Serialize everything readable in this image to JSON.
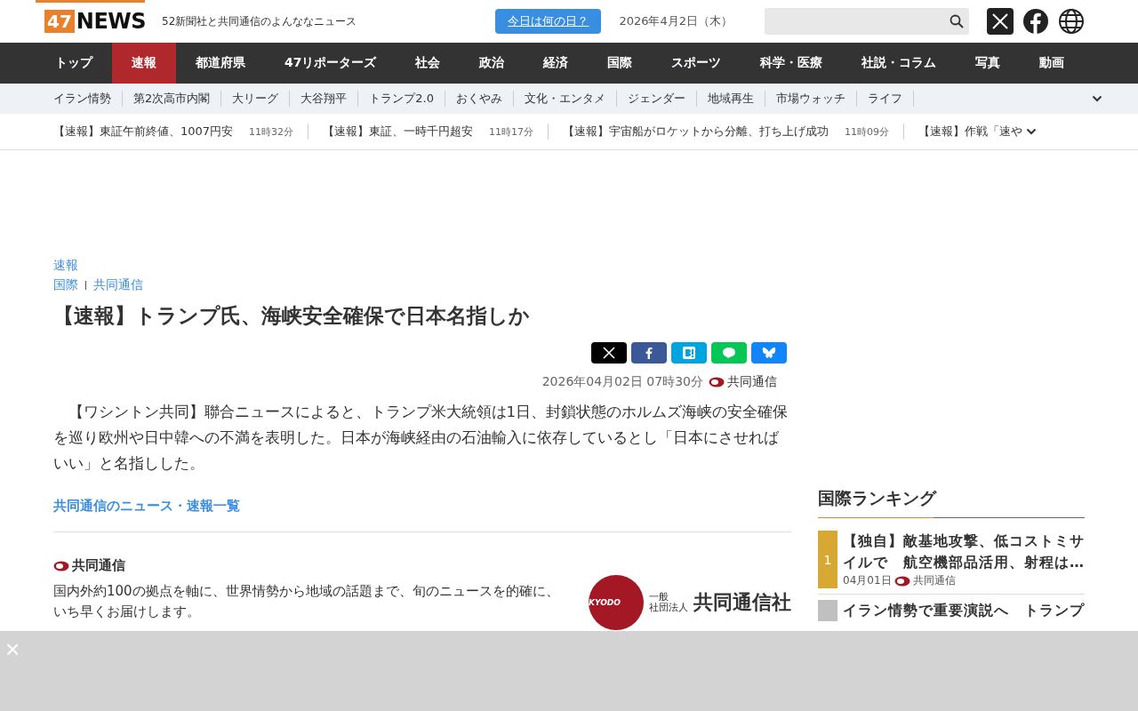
{
  "header": {
    "logo": {
      "number": "47",
      "word": "NEWS"
    },
    "tagline": "52新聞社と共同通信のよんななニュース",
    "today_button": "今日は何の日？",
    "date": "2026年4月2日（木）"
  },
  "main_nav": [
    {
      "label": "トップ",
      "selected": false
    },
    {
      "label": "速報",
      "selected": true
    },
    {
      "label": "都道府県",
      "selected": false
    },
    {
      "label": "47リポーターズ",
      "selected": false
    },
    {
      "label": "社会",
      "selected": false
    },
    {
      "label": "政治",
      "selected": false
    },
    {
      "label": "経済",
      "selected": false
    },
    {
      "label": "国際",
      "selected": false
    },
    {
      "label": "スポーツ",
      "selected": false
    },
    {
      "label": "科学・医療",
      "selected": false
    },
    {
      "label": "社説・コラム",
      "selected": false
    },
    {
      "label": "写真",
      "selected": false
    },
    {
      "label": "動画",
      "selected": false
    }
  ],
  "topic_nav": [
    "イラン情勢",
    "第2次高市内閣",
    "大リーグ",
    "大谷翔平",
    "トランプ2.0",
    "おくやみ",
    "文化・エンタメ",
    "ジェンダー",
    "地域再生",
    "市場ウォッチ",
    "ライフ"
  ],
  "ticker": [
    {
      "headline": "【速報】東証午前終値、1007円安",
      "time": "11時32分"
    },
    {
      "headline": "【速報】東証、一時千円超安",
      "time": "11時17分"
    },
    {
      "headline": "【速報】宇宙船がロケットから分離、打ち上げ成功",
      "time": "11時09分"
    },
    {
      "headline": "【速報】作戦「速や"
    }
  ],
  "article": {
    "category": "速報",
    "breadcrumbs": [
      "国際",
      "共同通信"
    ],
    "title": "【速報】トランプ氏、海峡安全確保で日本名指しか",
    "share_buttons": [
      {
        "kind": "x",
        "color": "#000000"
      },
      {
        "kind": "facebook",
        "color": "#3b5998"
      },
      {
        "kind": "hatena",
        "color": "#00a4de"
      },
      {
        "kind": "line",
        "color": "#06c755"
      },
      {
        "kind": "bluesky",
        "color": "#1185fe"
      }
    ],
    "datetime": "2026年04月02日 07時30分",
    "source": "共同通信",
    "body": "【ワシントン共同】聯合ニュースによると、トランプ米大統領は1日、封鎖状態のホルムズ海峡の安全確保を巡り欧州や日中韓への不満を表明した。日本が海峡経由の石油輸入に依存しているとし「日本にさせればいい」と名指しした。",
    "list_link": "共同通信のニュース・速報一覧"
  },
  "publisher": {
    "name": "共同通信",
    "description": "国内外約100の拠点を軸に、世界情勢から地域の話題まで、旬のニュースを的確に、いち早くお届けします。",
    "logo": {
      "mark": "KYODO",
      "small_top": "一般",
      "small_bottom": "社団法人",
      "name": "共同通信社"
    }
  },
  "ranking": {
    "title": "国際ランキング",
    "items": [
      {
        "rank": "1",
        "title": "【独自】敵基地攻撃、低コストミサイルで　航空機部品活用、射程は…",
        "date": "04月01日",
        "source": "共同通信",
        "color": "#d9a832"
      },
      {
        "title": "イラン情勢で重要演説へ　トランプ",
        "color": "#c0c0c0"
      }
    ]
  },
  "overlay": {
    "close": "×"
  }
}
